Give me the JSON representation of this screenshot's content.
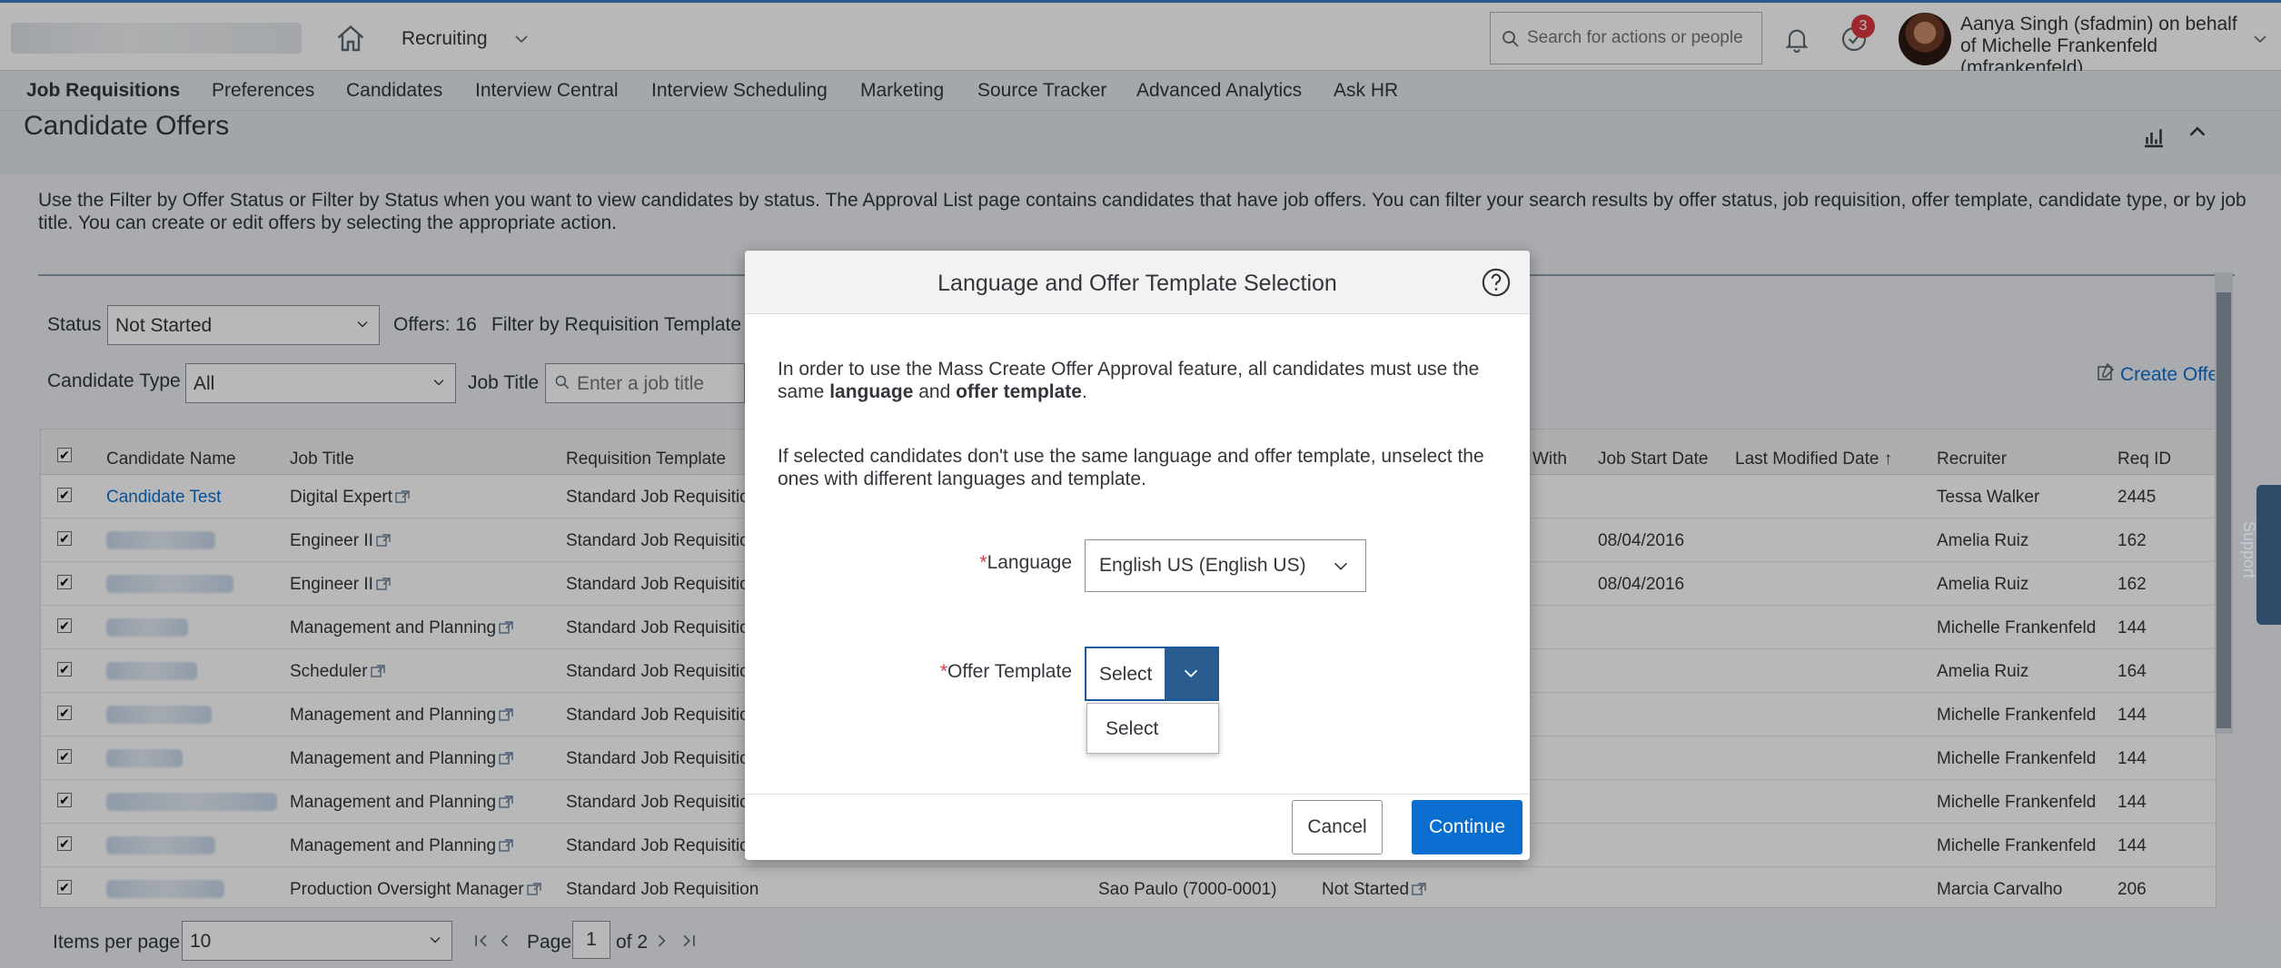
{
  "shell": {
    "module": "Recruiting",
    "search_placeholder": "Search for actions or people",
    "notification_badge": "3",
    "user_line1": "Aanya Singh (sfadmin) on behalf",
    "user_line2": "of Michelle Frankenfeld",
    "user_line3": "(mfrankenfeld)"
  },
  "nav": {
    "items": [
      "Job Requisitions",
      "Preferences",
      "Candidates",
      "Interview Central",
      "Interview Scheduling",
      "Marketing",
      "Source Tracker",
      "Advanced Analytics",
      "Ask HR"
    ]
  },
  "page": {
    "title": "Candidate Offers",
    "description": "Use the Filter by Offer Status or Filter by Status when you want to view candidates by status. The Approval List page contains candidates that have job offers. You can filter your search results by offer status, job requisition, offer template, candidate type, or by job title. You can create or edit offers by selecting the appropriate action."
  },
  "filters": {
    "status_label": "Status",
    "status_value": "Not Started",
    "offers_count": "Offers: 16",
    "filter_req_label": "Filter by Requisition Template",
    "candidate_type_label": "Candidate Type",
    "candidate_type_value": "All",
    "job_title_label": "Job Title",
    "job_title_placeholder": "Enter a job title",
    "create_offer": "Create Offer"
  },
  "table": {
    "headers": {
      "candidate_name": "Candidate Name",
      "job_title": "Job Title",
      "req_template": "Requisition Template",
      "with": "With",
      "job_start": "Job Start Date",
      "last_modified": "Last Modified Date",
      "recruiter": "Recruiter",
      "req_id": "Req ID"
    },
    "rows": [
      {
        "name": "Candidate Test",
        "job": "Digital Expert",
        "tmpl": "Standard Job Requisition",
        "loc": "",
        "status": "",
        "start": "",
        "recruiter": "Tessa Walker",
        "req": "2445"
      },
      {
        "name": "",
        "job": "Engineer II",
        "tmpl": "Standard Job Requisition",
        "loc": "",
        "status": "",
        "start": "08/04/2016",
        "recruiter": "Amelia Ruiz",
        "req": "162"
      },
      {
        "name": "",
        "job": "Engineer II",
        "tmpl": "Standard Job Requisition",
        "loc": "",
        "status": "",
        "start": "08/04/2016",
        "recruiter": "Amelia Ruiz",
        "req": "162"
      },
      {
        "name": "",
        "job": "Management and Planning",
        "tmpl": "Standard Job Requisition",
        "loc": "",
        "status": "",
        "start": "",
        "recruiter": "Michelle Frankenfeld",
        "req": "144"
      },
      {
        "name": "",
        "job": "Scheduler",
        "tmpl": "Standard Job Requisition",
        "loc": "",
        "status": "",
        "start": "",
        "recruiter": "Amelia Ruiz",
        "req": "164"
      },
      {
        "name": "",
        "job": "Management and Planning",
        "tmpl": "Standard Job Requisition",
        "loc": "",
        "status": "",
        "start": "",
        "recruiter": "Michelle Frankenfeld",
        "req": "144"
      },
      {
        "name": "",
        "job": "Management and Planning",
        "tmpl": "Standard Job Requisition",
        "loc": "",
        "status": "",
        "start": "",
        "recruiter": "Michelle Frankenfeld",
        "req": "144"
      },
      {
        "name": "",
        "job": "Management and Planning",
        "tmpl": "Standard Job Requisition",
        "loc": "",
        "status": "",
        "start": "",
        "recruiter": "Michelle Frankenfeld",
        "req": "144"
      },
      {
        "name": "",
        "job": "Management and Planning",
        "tmpl": "Standard Job Requisition",
        "loc": "",
        "status": "",
        "start": "",
        "recruiter": "Michelle Frankenfeld",
        "req": "144"
      },
      {
        "name": "",
        "job": "Production Oversight Manager",
        "tmpl": "Standard Job Requisition",
        "loc": "Sao Paulo (7000-0001)",
        "status": "Not Started",
        "start": "",
        "recruiter": "Marcia Carvalho",
        "req": "206"
      }
    ]
  },
  "pager": {
    "items_label": "Items per page",
    "items_value": "10",
    "page_label": "Page",
    "page_value": "1",
    "of_label": "of 2"
  },
  "support": {
    "label": "Support"
  },
  "dialog": {
    "title": "Language and Offer Template Selection",
    "text1_pre": "In order to use the Mass Create Offer Approval feature, all candidates must use the same ",
    "text1_b1": "language",
    "text1_mid": " and ",
    "text1_b2": "offer template",
    "text1_post": ".",
    "text2": "If selected candidates don't use the same language and offer template, unselect the ones with different languages and template.",
    "language_label": "Language",
    "language_value": "English US (English US)",
    "template_label": "Offer Template",
    "template_value": "Select",
    "template_options": [
      "Select"
    ],
    "cancel": "Cancel",
    "continue": "Continue"
  }
}
